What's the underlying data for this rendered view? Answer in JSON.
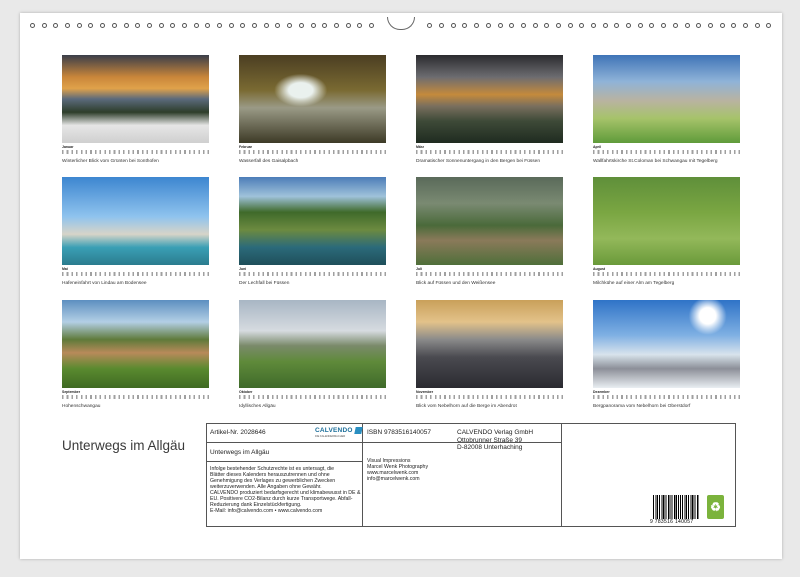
{
  "calendar": {
    "title": "Unterwegs im Allgäu",
    "months": [
      {
        "name": "Januar",
        "caption": "Winterlicher Blick vom Grünten bei Sonthofen"
      },
      {
        "name": "Februar",
        "caption": "Wasserfall des Gaisalpbach"
      },
      {
        "name": "März",
        "caption": "Dramatischer Sonnenuntergang in den Bergen bei Füssen"
      },
      {
        "name": "April",
        "caption": "Wallfahrtskirche St.Coloman bei Schwangau mit Tegelberg"
      },
      {
        "name": "Mai",
        "caption": "Hafeneinfahrt von Lindau am Bodensee"
      },
      {
        "name": "Juni",
        "caption": "Der Lechfall bei Füssen"
      },
      {
        "name": "Juli",
        "caption": "Blick auf Füssen und den Weißensee"
      },
      {
        "name": "August",
        "caption": "Milchkühe auf einer Alm am Tegelberg"
      },
      {
        "name": "September",
        "caption": "Hohenschwangau"
      },
      {
        "name": "Oktober",
        "caption": "Idyllisches Allgäu"
      },
      {
        "name": "November",
        "caption": "Blick vom Nebelhorn auf die Berge im Abendrot"
      },
      {
        "name": "Dezember",
        "caption": "Bergpanorama vom Nebelhorn bei Oberstdorf"
      }
    ]
  },
  "info": {
    "article_no": "Artikel-Nr. 2028646",
    "product_title": "Unterwegs im Allgäu",
    "legal_text": [
      "Infolge bestehender Schutzrechte ist es untersagt, die",
      "Blätter dieses Kalenders herauszutrennen und ohne",
      "Genehmigung des Verlages zu gewerblichen Zwecken",
      "weiterzuverwenden. Alle Angaben ohne Gewähr.",
      "CALVENDO produziert bedarfsgerecht und klimabewusst in DE &",
      "EU. Positivere CO2-Bilanz durch kurze Transportwege. Abfall-",
      "Reduzierung dank Einzelstückfertigung.",
      "E-Mail: info@calvendo.com • www.calvendo.com"
    ],
    "isbn": "ISBN 9783516140057",
    "author_lines": [
      "Visual Impressions",
      "Marcel Wenk Photography",
      "www.marcelwenk.com",
      "info@marcelwenk.com"
    ],
    "publisher_lines": [
      "CALVENDO Verlag GmbH",
      "Ottobrunner Straße 39",
      "D-82008 Unterhaching"
    ],
    "barcode_number": "9 783516 140057",
    "logo_text": "CALVENDO",
    "logo_sub": "DIE KALENDERMACHER",
    "eco_icon": "leaf-icon",
    "colors": {
      "logo_blue": "#1b6e9a",
      "eco_green": "#7bb33c"
    }
  }
}
